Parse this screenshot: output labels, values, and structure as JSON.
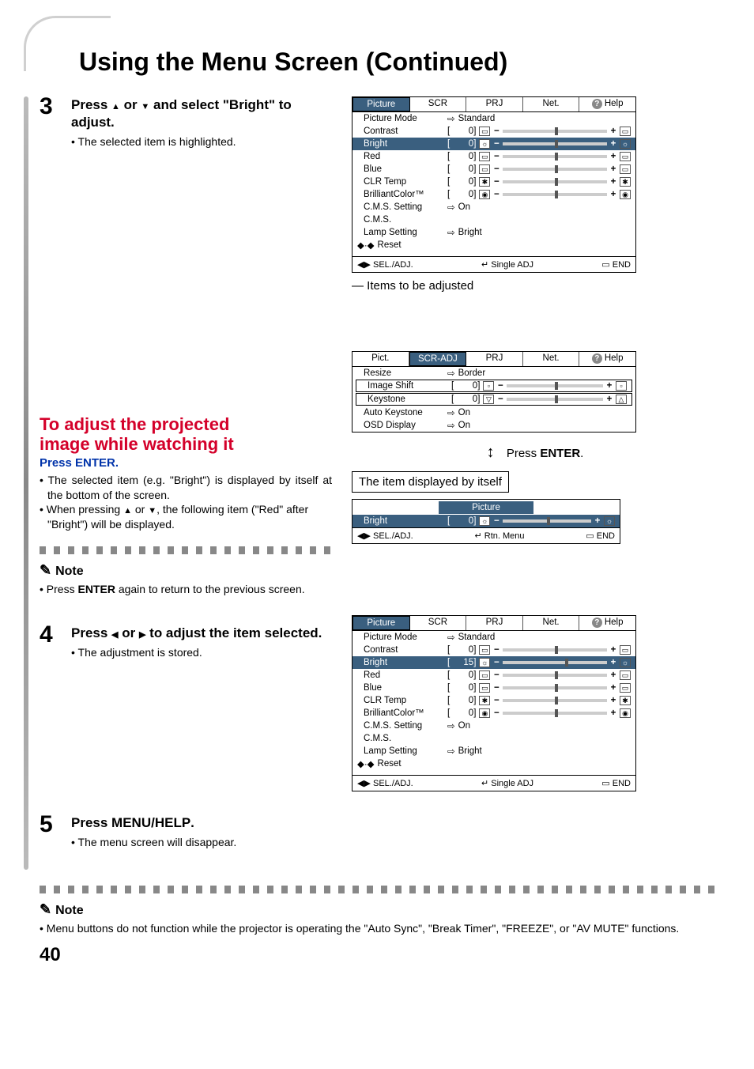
{
  "page_title": "Using the Menu Screen (Continued)",
  "page_number": "40",
  "step3": {
    "num": "3",
    "head_pre": "Press ",
    "head_post": " and select \"Bright\" to adjust.",
    "sub": "The selected item is highlighted."
  },
  "redblock": {
    "title1": "To adjust the projected",
    "title2": "image while watching it",
    "sub_pre": "Press ",
    "sub_key": "ENTER",
    "sub_post": ".",
    "b1": "The selected item (e.g. \"Bright\") is displayed by itself at the bottom of the screen.",
    "b2_pre": "When pressing ",
    "b2_post": ", the following item (\"Red\" after \"Bright\") will be displayed."
  },
  "note1": {
    "label": "Note",
    "text_pre": "Press ",
    "text_key": "ENTER",
    "text_post": " again to return to the previous screen."
  },
  "step4": {
    "num": "4",
    "head_pre": "Press ",
    "head_post": " to adjust the item selected.",
    "sub": "The adjustment is stored."
  },
  "step5": {
    "num": "5",
    "head_pre": "Press ",
    "head_key": "MENU/HELP",
    "head_post": ".",
    "sub": "The menu screen will disappear."
  },
  "bottom_note": {
    "label": "Note",
    "text": "Menu buttons do not function while the projector is operating the \"Auto Sync\", \"Break Timer\", \"FREEZE\", or \"AV MUTE\" functions."
  },
  "menu1": {
    "tabs": [
      "Picture",
      "SCR",
      "PRJ",
      "Net.",
      "Help"
    ],
    "active_tab": 0,
    "rows": {
      "picture_mode": {
        "label": "Picture Mode",
        "value": "Standard"
      },
      "contrast": {
        "label": "Contrast",
        "num": "0"
      },
      "bright": {
        "label": "Bright",
        "num": "0",
        "sel": true
      },
      "red": {
        "label": "Red",
        "num": "0"
      },
      "blue": {
        "label": "Blue",
        "num": "0"
      },
      "clr_temp": {
        "label": "CLR Temp",
        "num": "0"
      },
      "brilliant": {
        "label": "BrilliantColor™",
        "num": "0"
      },
      "cms_setting": {
        "label": "C.M.S. Setting",
        "value": "On"
      },
      "cms": {
        "label": "C.M.S."
      },
      "lamp": {
        "label": "Lamp Setting",
        "value": "Bright"
      },
      "reset": {
        "label": "Reset"
      }
    },
    "bottom": {
      "sel": "SEL./ADJ.",
      "mid": "Single ADJ",
      "end": "END"
    },
    "caption": "Items to be adjusted"
  },
  "menu2": {
    "tabs": [
      "Pict.",
      "SCR-ADJ",
      "PRJ",
      "Net.",
      "Help"
    ],
    "active_tab": 1,
    "rows": {
      "resize": {
        "label": "Resize",
        "value": "Border"
      },
      "image_shift": {
        "label": "Image Shift",
        "num": "0"
      },
      "keystone": {
        "label": "Keystone",
        "num": "0"
      },
      "auto_keystone": {
        "label": "Auto Keystone",
        "value": "On"
      },
      "osd": {
        "label": "OSD Display",
        "value": "On"
      }
    },
    "press_enter_pre": "Press ",
    "press_enter_key": "ENTER",
    "press_enter_post": ".",
    "item_caption": "The item displayed by itself"
  },
  "single": {
    "title": "Picture",
    "row": {
      "label": "Bright",
      "num": "0"
    },
    "bottom": {
      "sel": "SEL./ADJ.",
      "mid": "Rtn. Menu",
      "end": "END"
    }
  },
  "menu3": {
    "tabs": [
      "Picture",
      "SCR",
      "PRJ",
      "Net.",
      "Help"
    ],
    "active_tab": 0,
    "rows": {
      "picture_mode": {
        "label": "Picture Mode",
        "value": "Standard"
      },
      "contrast": {
        "label": "Contrast",
        "num": "0"
      },
      "bright": {
        "label": "Bright",
        "num": "15",
        "sel": true,
        "thumb": 60
      },
      "red": {
        "label": "Red",
        "num": "0"
      },
      "blue": {
        "label": "Blue",
        "num": "0"
      },
      "clr_temp": {
        "label": "CLR Temp",
        "num": "0"
      },
      "brilliant": {
        "label": "BrilliantColor™",
        "num": "0"
      },
      "cms_setting": {
        "label": "C.M.S. Setting",
        "value": "On"
      },
      "cms": {
        "label": "C.M.S."
      },
      "lamp": {
        "label": "Lamp Setting",
        "value": "Bright"
      },
      "reset": {
        "label": "Reset"
      }
    },
    "bottom": {
      "sel": "SEL./ADJ.",
      "mid": "Single ADJ",
      "end": "END"
    }
  }
}
